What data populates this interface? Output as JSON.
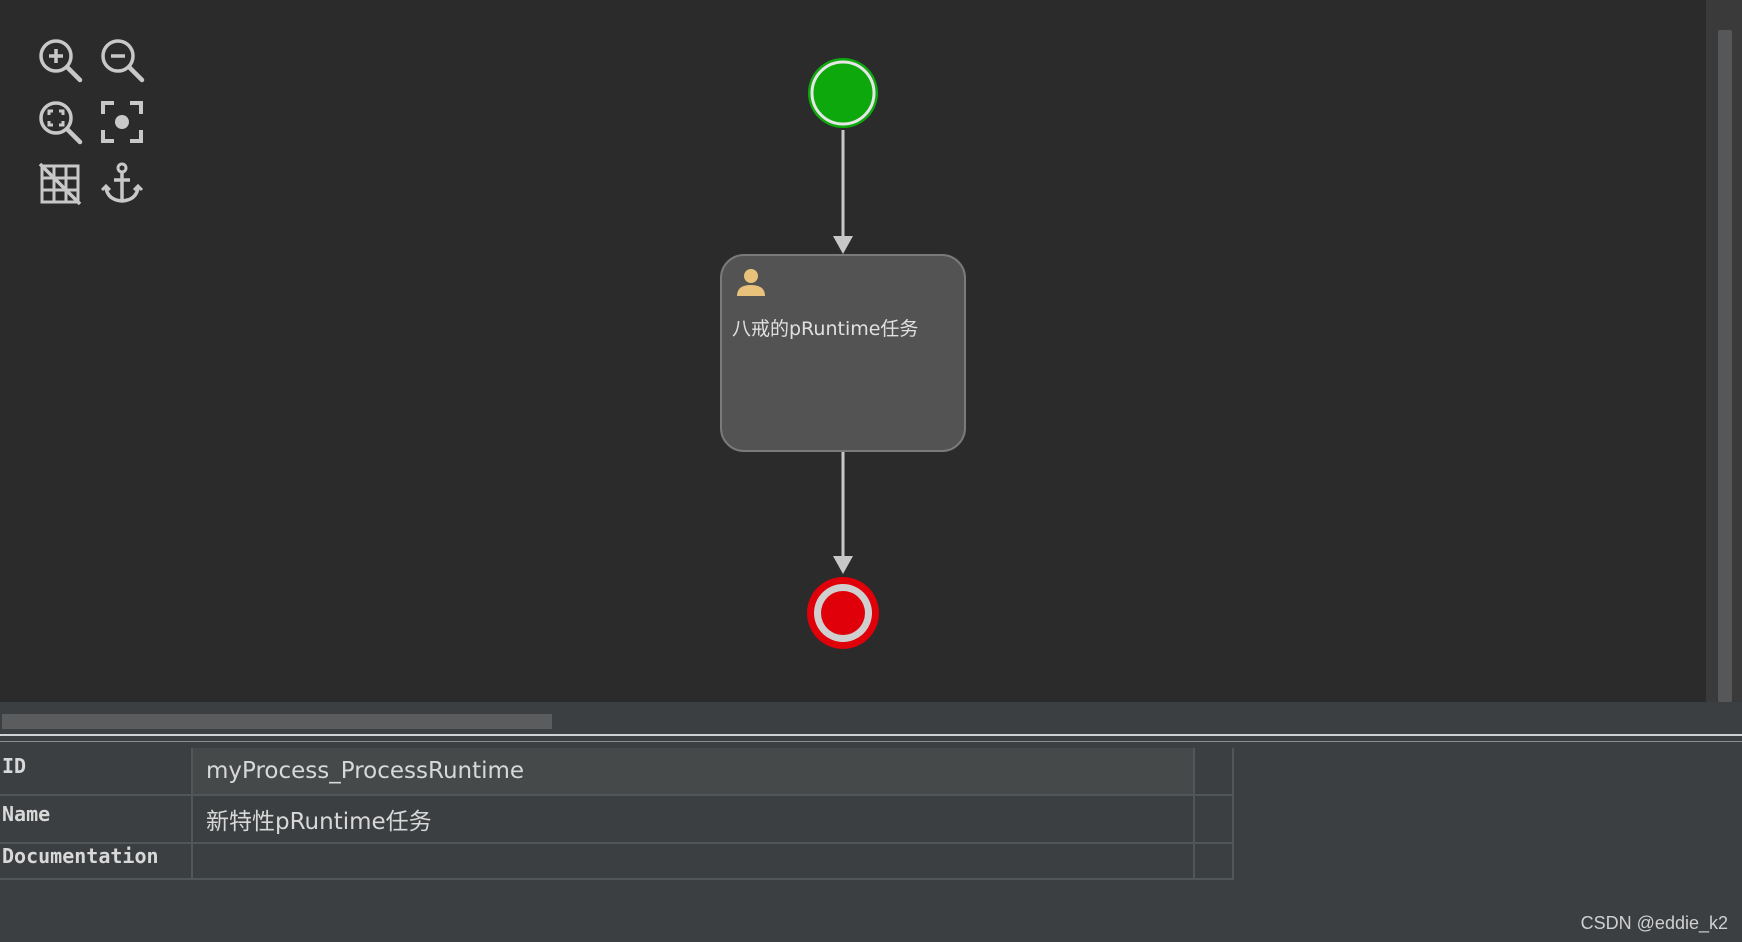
{
  "toolbar": {
    "icons": [
      "zoom-in-icon",
      "zoom-out-icon",
      "zoom-fit-icon",
      "center-focus-icon",
      "grid-toggle-icon",
      "anchor-icon"
    ]
  },
  "diagram": {
    "start_event_color": "#0ca80c",
    "end_event_color": "#e0000a",
    "task": {
      "label": "八戒的pRuntime任务",
      "icon": "user-icon"
    }
  },
  "properties": {
    "rows": [
      {
        "key": "ID",
        "value": "myProcess_ProcessRuntime"
      },
      {
        "key": "Name",
        "value": "新特性pRuntime任务"
      },
      {
        "key": "Documentation",
        "value": ""
      }
    ]
  },
  "watermark": "CSDN @eddie_k2"
}
